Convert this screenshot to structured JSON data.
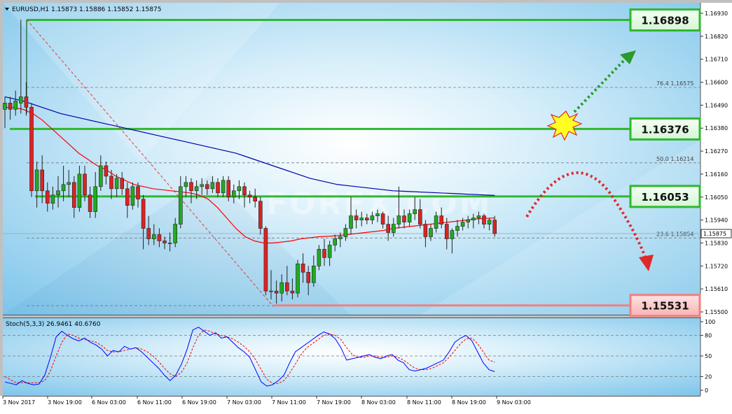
{
  "header": {
    "symbol_line": "EURUSD,H1  1.15873 1.15886 1.15852 1.15875",
    "stoch_line": "Stoch(5,3,3) 26.9461 40.6760"
  },
  "price_axis": {
    "ticks": [
      "1.16930",
      "1.16820",
      "1.16710",
      "1.16600",
      "1.16490",
      "1.16380",
      "1.16270",
      "1.16160",
      "1.16050",
      "1.15940",
      "1.15830",
      "1.15720",
      "1.15610",
      "1.15500"
    ],
    "current_price": "1.15875"
  },
  "stoch_axis": {
    "ticks": [
      "100",
      "80",
      "50",
      "20",
      "0"
    ]
  },
  "time_axis": {
    "labels": [
      "3 Nov 2017",
      "3 Nov 19:00",
      "6 Nov 03:00",
      "6 Nov 11:00",
      "6 Nov 19:00",
      "7 Nov 03:00",
      "7 Nov 11:00",
      "7 Nov 19:00",
      "8 Nov 03:00",
      "8 Nov 11:00",
      "8 Nov 19:00",
      "9 Nov 03:00"
    ]
  },
  "fib_levels": [
    {
      "ratio": "76.4",
      "price": "1.16575"
    },
    {
      "ratio": "50.0",
      "price": "1.16214"
    },
    {
      "ratio": "23.6",
      "price": "1.15854"
    }
  ],
  "levels": [
    {
      "price": "1.16898",
      "kind": "resistance"
    },
    {
      "price": "1.16376",
      "kind": "resistance"
    },
    {
      "price": "1.16053",
      "kind": "resistance"
    },
    {
      "price": "1.15531",
      "kind": "support"
    }
  ],
  "watermark": "FOREX.COM",
  "colors": {
    "bull_candle": "#22aa22",
    "bear_candle": "#dd2222",
    "ma_fast": "#ff0000",
    "ma_slow": "#0000aa",
    "level_green": "#2eb82e",
    "level_red": "#f08080",
    "stoch_main": "#0000ff",
    "stoch_signal": "#ff0000"
  },
  "chart_data": {
    "type": "candlestick",
    "symbol": "EURUSD",
    "timeframe": "H1",
    "ylim": [
      1.1547,
      1.1698
    ],
    "candles_ohlc": [
      [
        1.1647,
        1.1653,
        1.1638,
        1.165
      ],
      [
        1.165,
        1.1653,
        1.1642,
        1.1647
      ],
      [
        1.1647,
        1.1656,
        1.1644,
        1.1651
      ],
      [
        1.165,
        1.169,
        1.1645,
        1.1653
      ],
      [
        1.1653,
        1.166,
        1.1644,
        1.1648
      ],
      [
        1.1648,
        1.165,
        1.1605,
        1.1608
      ],
      [
        1.1608,
        1.1622,
        1.16,
        1.1618
      ],
      [
        1.1618,
        1.1625,
        1.1602,
        1.1608
      ],
      [
        1.1608,
        1.1612,
        1.1598,
        1.1602
      ],
      [
        1.1602,
        1.161,
        1.1599,
        1.1606
      ],
      [
        1.1606,
        1.1615,
        1.16,
        1.1608
      ],
      [
        1.1608,
        1.162,
        1.1603,
        1.1611
      ],
      [
        1.1611,
        1.1618,
        1.1605,
        1.1612
      ],
      [
        1.1612,
        1.1615,
        1.1595,
        1.16
      ],
      [
        1.16,
        1.162,
        1.1598,
        1.1616
      ],
      [
        1.1616,
        1.162,
        1.1603,
        1.1606
      ],
      [
        1.1606,
        1.161,
        1.1595,
        1.1598
      ],
      [
        1.1598,
        1.1617,
        1.1595,
        1.161
      ],
      [
        1.161,
        1.1625,
        1.1608,
        1.162
      ],
      [
        1.162,
        1.1622,
        1.1611,
        1.1615
      ],
      [
        1.1615,
        1.1618,
        1.1604,
        1.1609
      ],
      [
        1.1609,
        1.1616,
        1.1605,
        1.1614
      ],
      [
        1.1614,
        1.1617,
        1.1606,
        1.1609
      ],
      [
        1.1609,
        1.1612,
        1.1595,
        1.1601
      ],
      [
        1.1601,
        1.1612,
        1.1599,
        1.161
      ],
      [
        1.161,
        1.1612,
        1.16,
        1.1604
      ],
      [
        1.1604,
        1.1606,
        1.158,
        1.159
      ],
      [
        1.159,
        1.1596,
        1.1582,
        1.1585
      ],
      [
        1.1585,
        1.1592,
        1.1582,
        1.1587
      ],
      [
        1.1587,
        1.159,
        1.1581,
        1.1584
      ],
      [
        1.1584,
        1.1586,
        1.158,
        1.1583
      ],
      [
        1.1583,
        1.1588,
        1.1579,
        1.1583
      ],
      [
        1.1583,
        1.1595,
        1.1581,
        1.1592
      ],
      [
        1.1592,
        1.1615,
        1.159,
        1.161
      ],
      [
        1.161,
        1.1615,
        1.1605,
        1.1612
      ],
      [
        1.1612,
        1.1614,
        1.1602,
        1.1608
      ],
      [
        1.1608,
        1.1613,
        1.1604,
        1.161
      ],
      [
        1.161,
        1.1614,
        1.1606,
        1.1611
      ],
      [
        1.1611,
        1.1613,
        1.1606,
        1.1609
      ],
      [
        1.1609,
        1.1615,
        1.1607,
        1.1612
      ],
      [
        1.1612,
        1.1614,
        1.1605,
        1.1607
      ],
      [
        1.1607,
        1.1615,
        1.1605,
        1.1613
      ],
      [
        1.1613,
        1.1615,
        1.1603,
        1.1605
      ],
      [
        1.1605,
        1.1611,
        1.1602,
        1.1608
      ],
      [
        1.1608,
        1.1613,
        1.1604,
        1.161
      ],
      [
        1.161,
        1.1612,
        1.16,
        1.1606
      ],
      [
        1.1606,
        1.1608,
        1.1602,
        1.1605
      ],
      [
        1.1605,
        1.1609,
        1.16,
        1.1603
      ],
      [
        1.1603,
        1.1605,
        1.1587,
        1.159
      ],
      [
        1.159,
        1.1591,
        1.1558,
        1.156
      ],
      [
        1.156,
        1.157,
        1.1556,
        1.156
      ],
      [
        1.156,
        1.1565,
        1.1554,
        1.1559
      ],
      [
        1.1559,
        1.1568,
        1.1555,
        1.1564
      ],
      [
        1.1564,
        1.1572,
        1.1558,
        1.156
      ],
      [
        1.156,
        1.1566,
        1.1556,
        1.1559
      ],
      [
        1.1559,
        1.1575,
        1.1557,
        1.1573
      ],
      [
        1.1573,
        1.1578,
        1.1564,
        1.1569
      ],
      [
        1.1569,
        1.1572,
        1.1558,
        1.1564
      ],
      [
        1.1564,
        1.1577,
        1.1562,
        1.1572
      ],
      [
        1.1572,
        1.1582,
        1.157,
        1.158
      ],
      [
        1.158,
        1.1585,
        1.1572,
        1.1576
      ],
      [
        1.1576,
        1.1584,
        1.1572,
        1.1582
      ],
      [
        1.1582,
        1.1587,
        1.1579,
        1.1585
      ],
      [
        1.1585,
        1.1588,
        1.1581,
        1.1586
      ],
      [
        1.1586,
        1.1592,
        1.1584,
        1.159
      ],
      [
        1.159,
        1.1605,
        1.1587,
        1.1596
      ],
      [
        1.1596,
        1.1599,
        1.159,
        1.1594
      ],
      [
        1.1594,
        1.1598,
        1.1591,
        1.1595
      ],
      [
        1.1595,
        1.1597,
        1.1592,
        1.1594
      ],
      [
        1.1594,
        1.1598,
        1.1592,
        1.1596
      ],
      [
        1.1596,
        1.1599,
        1.1593,
        1.1597
      ],
      [
        1.1597,
        1.1598,
        1.159,
        1.1592
      ],
      [
        1.1592,
        1.1596,
        1.1584,
        1.1588
      ],
      [
        1.1588,
        1.1595,
        1.1586,
        1.1592
      ],
      [
        1.1592,
        1.161,
        1.159,
        1.1596
      ],
      [
        1.1596,
        1.1599,
        1.159,
        1.1593
      ],
      [
        1.1593,
        1.1599,
        1.1591,
        1.1597
      ],
      [
        1.1597,
        1.1605,
        1.1594,
        1.1599
      ],
      [
        1.1599,
        1.1604,
        1.159,
        1.1592
      ],
      [
        1.1592,
        1.1594,
        1.1581,
        1.1586
      ],
      [
        1.1586,
        1.1592,
        1.1584,
        1.159
      ],
      [
        1.159,
        1.1598,
        1.1588,
        1.1596
      ],
      [
        1.1596,
        1.16,
        1.159,
        1.1592
      ],
      [
        1.1592,
        1.1595,
        1.158,
        1.1585
      ],
      [
        1.1585,
        1.159,
        1.1578,
        1.1589
      ],
      [
        1.1589,
        1.1594,
        1.1586,
        1.1591
      ],
      [
        1.1591,
        1.1595,
        1.1589,
        1.1593
      ],
      [
        1.1593,
        1.1596,
        1.159,
        1.1594
      ],
      [
        1.1594,
        1.1597,
        1.159,
        1.1595
      ],
      [
        1.1595,
        1.1598,
        1.1592,
        1.1596
      ],
      [
        1.1596,
        1.1597,
        1.159,
        1.1592
      ],
      [
        1.1592,
        1.1595,
        1.1589,
        1.1594
      ],
      [
        1.1594,
        1.1596,
        1.1586,
        1.15875
      ]
    ],
    "ma_fast": [
      1.1648,
      1.16478,
      1.1647,
      1.1645,
      1.1642,
      1.1638,
      1.1634,
      1.163,
      1.1626,
      1.1623,
      1.162,
      1.1618,
      1.1615,
      1.1613,
      1.1611,
      1.161,
      1.1609,
      1.16085,
      1.1608,
      1.16075,
      1.1607,
      1.1606,
      1.1604,
      1.16,
      1.1595,
      1.159,
      1.1586,
      1.1584,
      1.1583,
      1.1583,
      1.15835,
      1.1584,
      1.1585,
      1.15855,
      1.1586,
      1.15862,
      1.15865,
      1.1587,
      1.15875,
      1.1588,
      1.15885,
      1.1589,
      1.159,
      1.15905,
      1.1591,
      1.15915,
      1.1592,
      1.15925,
      1.1593,
      1.15935,
      1.1594,
      1.15945,
      1.15948,
      1.1595
    ],
    "ma_slow": [
      1.1653,
      1.1652,
      1.1651,
      1.16495,
      1.1648,
      1.16465,
      1.1645,
      1.1644,
      1.1643,
      1.1642,
      1.1641,
      1.164,
      1.1639,
      1.1638,
      1.1637,
      1.1636,
      1.1635,
      1.1634,
      1.1633,
      1.1632,
      1.1631,
      1.163,
      1.1629,
      1.1628,
      1.1627,
      1.1626,
      1.16245,
      1.1623,
      1.16215,
      1.162,
      1.16185,
      1.1617,
      1.16155,
      1.1614,
      1.1613,
      1.1612,
      1.1611,
      1.16105,
      1.161,
      1.16095,
      1.1609,
      1.16085,
      1.1608,
      1.16078,
      1.16076,
      1.16074,
      1.16072,
      1.1607,
      1.16068,
      1.16066,
      1.16064,
      1.16062,
      1.1606,
      1.16058
    ],
    "stoch_k": [
      12,
      10,
      8,
      14,
      10,
      8,
      9,
      22,
      48,
      78,
      86,
      80,
      75,
      72,
      76,
      70,
      66,
      60,
      50,
      58,
      56,
      64,
      60,
      62,
      56,
      48,
      40,
      32,
      22,
      14,
      22,
      38,
      60,
      88,
      92,
      86,
      80,
      84,
      76,
      78,
      70,
      62,
      56,
      48,
      30,
      12,
      6,
      8,
      14,
      22,
      40,
      56,
      62,
      68,
      74,
      80,
      85,
      82,
      75,
      62,
      44,
      46,
      48,
      50,
      52,
      48,
      46,
      50,
      52,
      44,
      40,
      30,
      28,
      30,
      32,
      36,
      40,
      44,
      56,
      70,
      76,
      80,
      72,
      56,
      40,
      30,
      27
    ],
    "stoch_d": [
      20,
      15,
      11,
      11,
      11,
      11,
      11,
      14,
      28,
      50,
      70,
      82,
      80,
      76,
      74,
      72,
      70,
      65,
      58,
      56,
      56,
      58,
      60,
      62,
      60,
      56,
      50,
      42,
      32,
      24,
      20,
      26,
      40,
      62,
      80,
      88,
      86,
      82,
      80,
      78,
      75,
      70,
      64,
      56,
      45,
      30,
      16,
      10,
      10,
      14,
      25,
      38,
      52,
      62,
      68,
      74,
      80,
      82,
      80,
      74,
      62,
      52,
      48,
      48,
      50,
      50,
      48,
      48,
      50,
      48,
      44,
      38,
      32,
      30,
      30,
      32,
      36,
      40,
      48,
      58,
      68,
      75,
      76,
      68,
      56,
      44,
      41
    ]
  }
}
